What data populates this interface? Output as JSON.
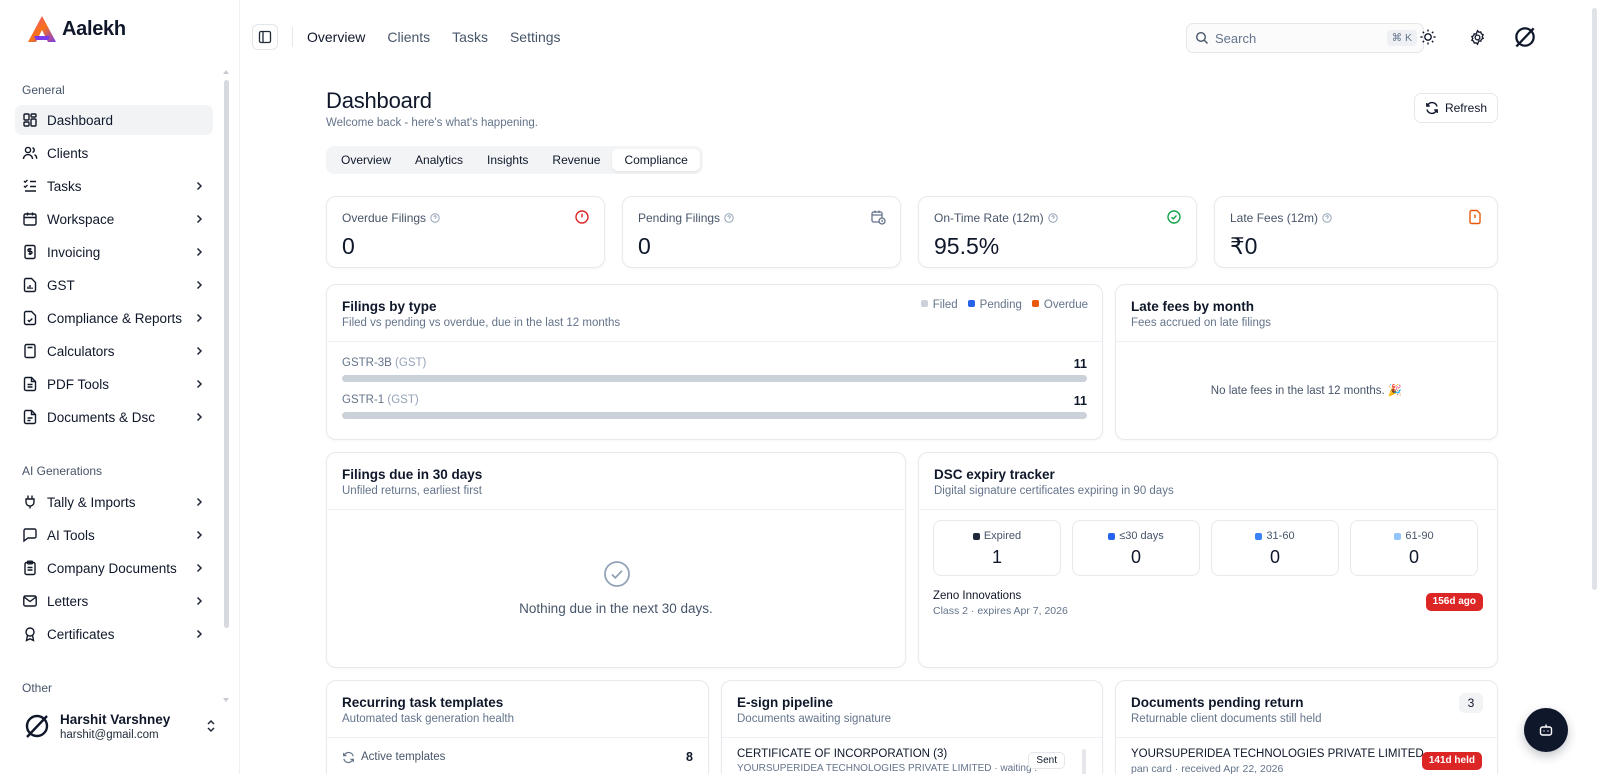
{
  "app": {
    "logo_text": "Aalekh"
  },
  "sidebar": {
    "sections": [
      {
        "title": "General",
        "items": [
          {
            "label": "Dashboard",
            "icon": "dashboard-icon",
            "active": true,
            "chevron": false
          },
          {
            "label": "Clients",
            "icon": "users-icon",
            "chevron": false
          },
          {
            "label": "Tasks",
            "icon": "list-checks-icon",
            "chevron": true
          },
          {
            "label": "Workspace",
            "icon": "calendar-icon",
            "chevron": true
          },
          {
            "label": "Invoicing",
            "icon": "receipt-icon",
            "chevron": true
          },
          {
            "label": "GST",
            "icon": "file-chart-icon",
            "chevron": true
          },
          {
            "label": "Compliance & Reports",
            "icon": "file-check-icon",
            "chevron": true
          },
          {
            "label": "Calculators",
            "icon": "calculator-icon",
            "chevron": true
          },
          {
            "label": "PDF Tools",
            "icon": "pdf-icon",
            "chevron": true
          },
          {
            "label": "Documents & Dsc",
            "icon": "document-icon",
            "chevron": true
          }
        ]
      },
      {
        "title": "AI Generations",
        "items": [
          {
            "label": "Tally & Imports",
            "icon": "plug-icon",
            "chevron": true
          },
          {
            "label": "AI Tools",
            "icon": "message-icon",
            "chevron": true
          },
          {
            "label": "Company Documents",
            "icon": "clipboard-icon",
            "chevron": true
          },
          {
            "label": "Letters",
            "icon": "mail-icon",
            "chevron": true
          },
          {
            "label": "Certificates",
            "icon": "award-icon",
            "chevron": true
          }
        ]
      },
      {
        "title": "Other",
        "items": []
      }
    ],
    "user": {
      "name": "Harshit Varshney",
      "email": "harshit@gmail.com"
    }
  },
  "topbar": {
    "tabs": [
      {
        "label": "Overview",
        "active": true
      },
      {
        "label": "Clients"
      },
      {
        "label": "Tasks"
      },
      {
        "label": "Settings"
      }
    ],
    "search": {
      "placeholder": "Search",
      "shortcut": "⌘ K"
    }
  },
  "page": {
    "title": "Dashboard",
    "subtitle": "Welcome back - here's what's happening.",
    "refresh_label": "Refresh",
    "tabs": [
      {
        "label": "Overview"
      },
      {
        "label": "Analytics"
      },
      {
        "label": "Insights"
      },
      {
        "label": "Revenue"
      },
      {
        "label": "Compliance",
        "active": true
      }
    ]
  },
  "kpis": [
    {
      "label": "Overdue Filings",
      "value": "0",
      "icon": "alert-circle-icon",
      "color": "#dc2626"
    },
    {
      "label": "Pending Filings",
      "value": "0",
      "icon": "calendar-clock-icon",
      "color": "#64748b"
    },
    {
      "label": "On-Time Rate (12m)",
      "value": "95.5%",
      "icon": "check-circle-icon",
      "color": "#16a34a"
    },
    {
      "label": "Late Fees (12m)",
      "value": "₹0",
      "icon": "file-warning-icon",
      "color": "#ea580c"
    }
  ],
  "filings_by_type": {
    "title": "Filings by type",
    "subtitle": "Filed vs pending vs overdue, due in the last 12 months",
    "legend": [
      {
        "label": "Filed",
        "color": "#cbd1d8"
      },
      {
        "label": "Pending",
        "color": "#2563eb"
      },
      {
        "label": "Overdue",
        "color": "#ea580c"
      }
    ],
    "rows": [
      {
        "name": "GSTR-3B",
        "tag": "(GST)",
        "count": "11",
        "filed_fraction": 1.0
      },
      {
        "name": "GSTR-1",
        "tag": "(GST)",
        "count": "11",
        "filed_fraction": 1.0
      }
    ]
  },
  "late_fees": {
    "title": "Late fees by month",
    "subtitle": "Fees accrued on late filings",
    "empty": "No late fees in the last 12 months. 🎉"
  },
  "filings_due": {
    "title": "Filings due in 30 days",
    "subtitle": "Unfiled returns, earliest first",
    "empty": "Nothing due in the next 30 days."
  },
  "dsc": {
    "title": "DSC expiry tracker",
    "subtitle": "Digital signature certificates expiring in 90 days",
    "buckets": [
      {
        "label": "Expired",
        "value": "1",
        "color": "#1e293b"
      },
      {
        "label": "≤30 days",
        "value": "0",
        "color": "#2563eb"
      },
      {
        "label": "31-60",
        "value": "0",
        "color": "#3b82f6"
      },
      {
        "label": "61-90",
        "value": "0",
        "color": "#93c5fd"
      }
    ],
    "item": {
      "name": "Zeno Innovations",
      "detail": "Class 2 · expires Apr 7, 2026",
      "badge": "156d ago"
    }
  },
  "recurring": {
    "title": "Recurring task templates",
    "subtitle": "Automated task generation health",
    "row_label": "Active templates",
    "row_value": "8"
  },
  "esign": {
    "title": "E-sign pipeline",
    "subtitle": "Documents awaiting signature",
    "item_title": "CERTIFICATE OF INCORPORATION (3)",
    "item_detail": "YOURSUPERIDEA TECHNOLOGIES PRIVATE LIMITED · waiting ...",
    "badge": "Sent"
  },
  "docs_pending": {
    "title": "Documents pending return",
    "subtitle": "Returnable client documents still held",
    "count": "3",
    "item_title": "YOURSUPERIDEA TECHNOLOGIES PRIVATE LIMITED",
    "item_detail": "pan card · received Apr 22, 2026",
    "badge": "141d held"
  }
}
